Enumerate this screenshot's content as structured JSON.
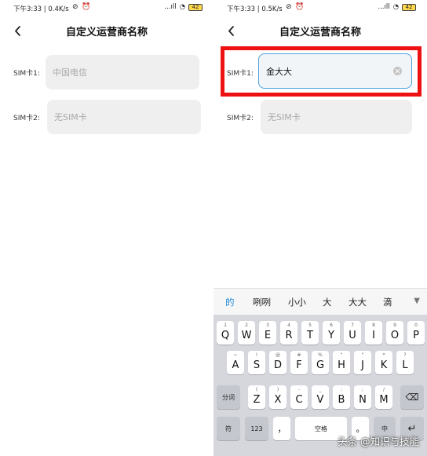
{
  "left": {
    "status": {
      "time": "下午3:33 | 0.4K/s",
      "signal": "...ıll",
      "battery": "42"
    },
    "header": {
      "title": "自定义运营商名称"
    },
    "sim1": {
      "label": "SIM卡1:",
      "placeholder": "中国电信"
    },
    "sim2": {
      "label": "SIM卡2:",
      "placeholder": "无SIM卡"
    }
  },
  "right": {
    "status": {
      "time": "下午3:33 | 0.5K/s",
      "signal": "...ıll",
      "battery": "42"
    },
    "header": {
      "title": "自定义运营商名称"
    },
    "sim1": {
      "label": "SIM卡1:",
      "value": "金大大"
    },
    "sim2": {
      "label": "SIM卡2:",
      "placeholder": "无SIM卡"
    },
    "highlight_color": "#ee1111",
    "candidates": [
      "的",
      "咧咧",
      "小小",
      "大",
      "大大",
      "滴"
    ],
    "candidate_expand": "▼",
    "keyboard": {
      "row1": [
        {
          "main": "Q",
          "sub": "1"
        },
        {
          "main": "W",
          "sub": "2"
        },
        {
          "main": "E",
          "sub": "3"
        },
        {
          "main": "R",
          "sub": "4"
        },
        {
          "main": "T",
          "sub": "5"
        },
        {
          "main": "Y",
          "sub": "6"
        },
        {
          "main": "U",
          "sub": "7"
        },
        {
          "main": "I",
          "sub": "8"
        },
        {
          "main": "O",
          "sub": "9"
        },
        {
          "main": "P",
          "sub": "0"
        }
      ],
      "row2": [
        {
          "main": "A",
          "sub": "~"
        },
        {
          "main": "S",
          "sub": "!"
        },
        {
          "main": "D",
          "sub": "@"
        },
        {
          "main": "F",
          "sub": "#"
        },
        {
          "main": "G",
          "sub": "%"
        },
        {
          "main": "H",
          "sub": "\""
        },
        {
          "main": "J",
          "sub": "\""
        },
        {
          "main": "K",
          "sub": "*"
        },
        {
          "main": "L",
          "sub": "?"
        }
      ],
      "row3": [
        {
          "main": "Z",
          "sub": "("
        },
        {
          "main": "X",
          "sub": ")"
        },
        {
          "main": "C",
          "sub": "-"
        },
        {
          "main": "V",
          "sub": "_"
        },
        {
          "main": "B",
          "sub": ":"
        },
        {
          "main": "N",
          "sub": ";"
        },
        {
          "main": "M",
          "sub": "/"
        }
      ],
      "split_key": "分词",
      "delete_key": "⌫",
      "symbol_key": "符",
      "number_key": "123",
      "comma_key": "，",
      "space_key": "空格",
      "period_key": "。",
      "lang_key": "中",
      "enter_key": "↵"
    },
    "watermark": "头条 @知识与技能"
  }
}
